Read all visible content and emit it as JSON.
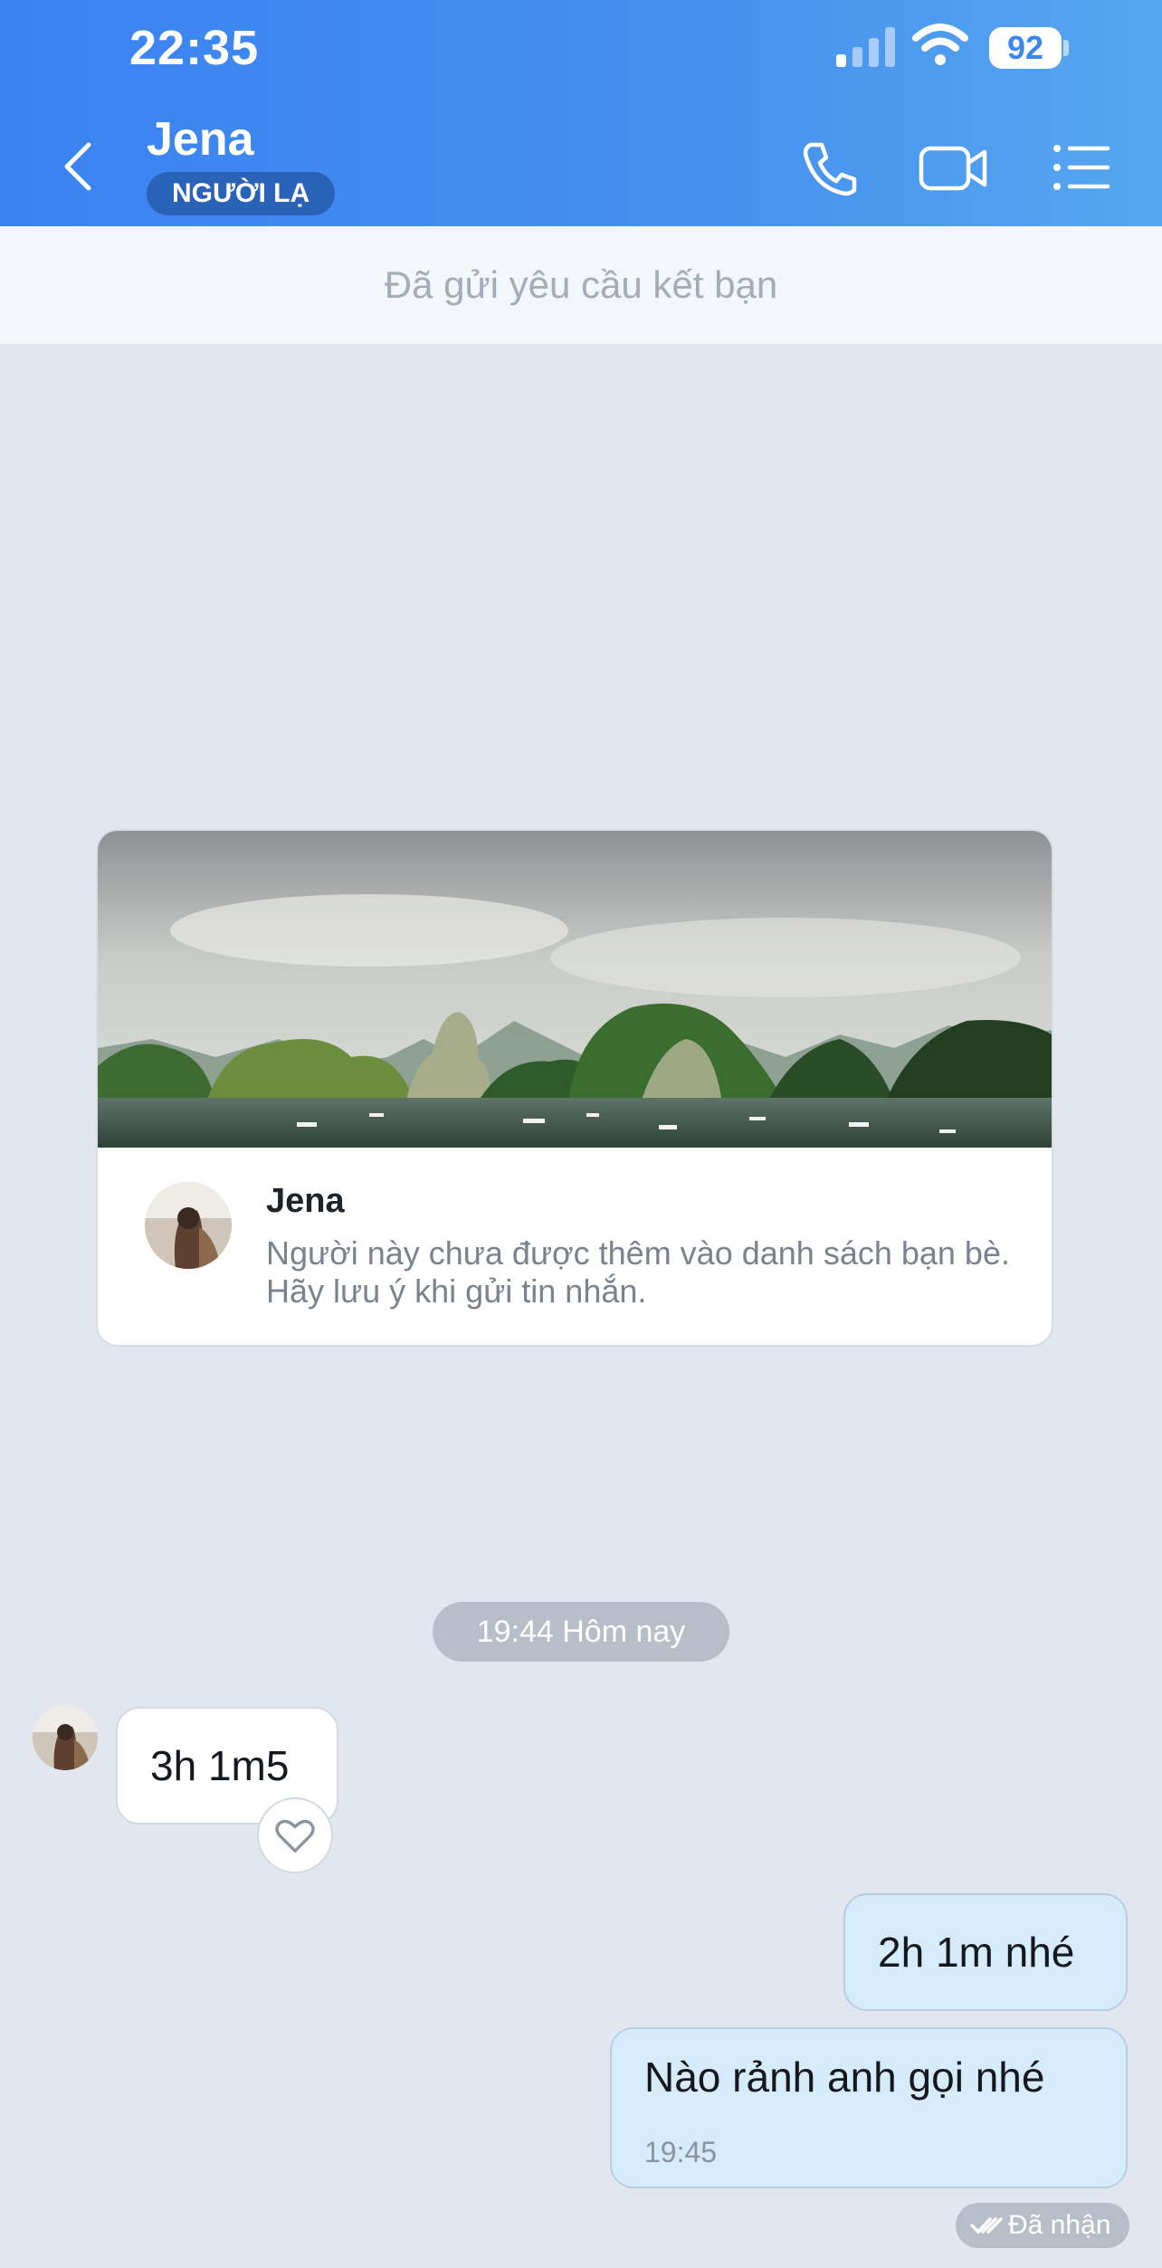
{
  "status_bar": {
    "time": "22:35",
    "battery": "92"
  },
  "header": {
    "title": "Jena",
    "badge": "NGƯỜI LẠ"
  },
  "friend_request_bar": {
    "text": "Đã gửi yêu cầu kết bạn"
  },
  "profile_card": {
    "name": "Jena",
    "description": "Người này chưa được thêm vào danh sách bạn bè. Hãy lưu ý khi gửi tin nhắn."
  },
  "chat": {
    "date_separator": "19:44 Hôm nay",
    "messages": [
      {
        "direction": "incoming",
        "text": "3h 1m5"
      },
      {
        "direction": "outgoing",
        "text": "2h 1m nhé"
      },
      {
        "direction": "outgoing",
        "text": "Nào rảnh anh gọi nhé",
        "time": "19:45"
      }
    ],
    "status": "Đã nhận"
  },
  "colors": {
    "header_start": "#3a82f0",
    "header_end": "#55a7ef",
    "background": "#e2e7ef",
    "outgoing_bubble": "#d6ebfb",
    "badge": "#2a62b8"
  },
  "icons": [
    "back-chevron-icon",
    "phone-icon",
    "video-call-icon",
    "menu-list-icon",
    "heart-icon",
    "double-check-icon",
    "signal-icon",
    "wifi-icon",
    "battery-icon"
  ]
}
